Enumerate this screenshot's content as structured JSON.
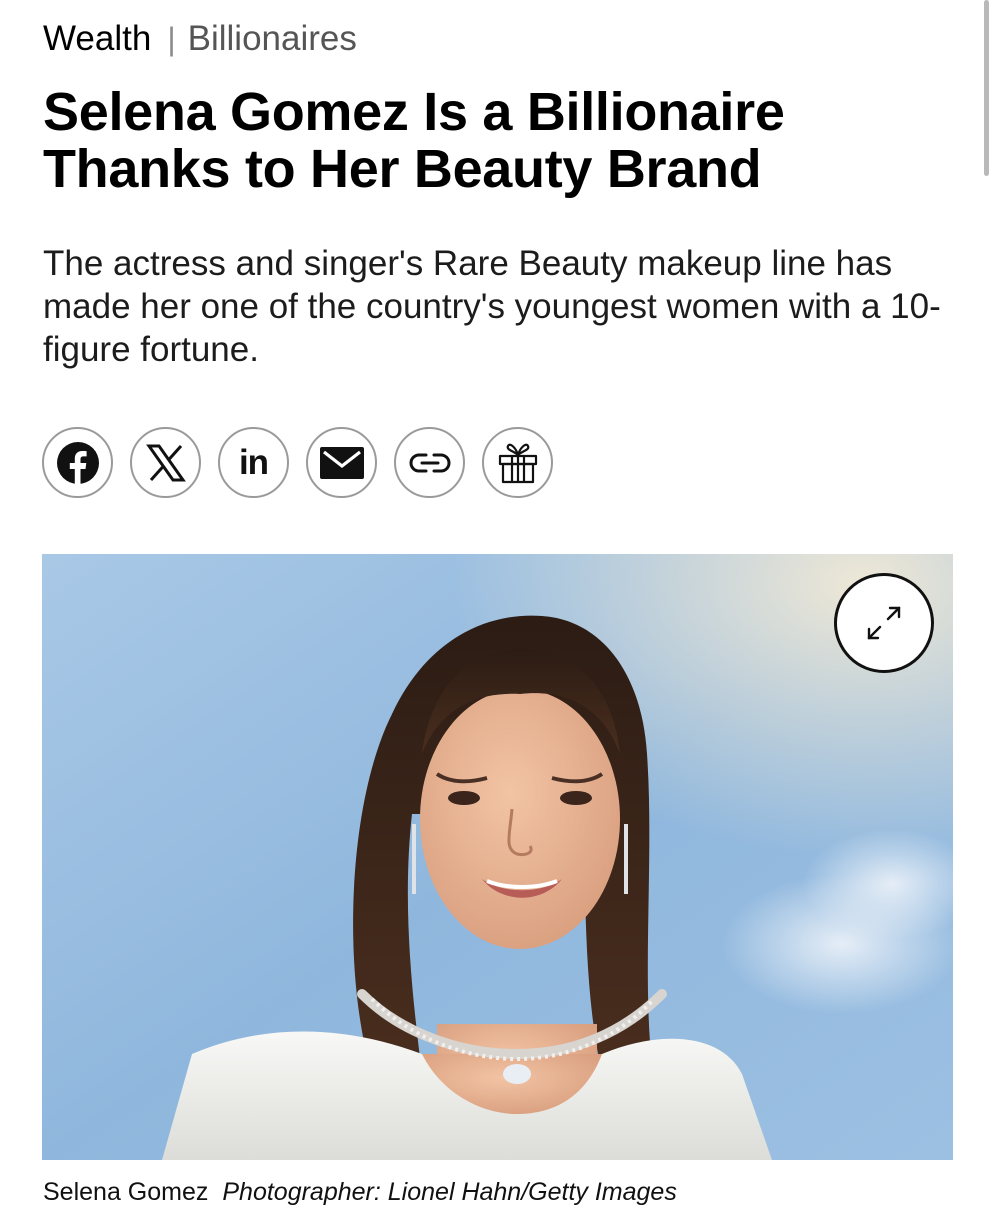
{
  "breadcrumb": {
    "section": "Wealth",
    "separator": "|",
    "subsection": "Billionaires"
  },
  "article": {
    "headline": "Selena Gomez Is a Billionaire Thanks to Her Beauty Brand",
    "dek": "The actress and singer's Rare Beauty makeup line has made her one of the country's youngest women with a 10-figure fortune."
  },
  "share": {
    "buttons": [
      {
        "icon": "facebook-icon"
      },
      {
        "icon": "x-icon"
      },
      {
        "icon": "linkedin-icon",
        "label": "in"
      },
      {
        "icon": "email-icon"
      },
      {
        "icon": "link-icon"
      },
      {
        "icon": "gift-icon"
      }
    ]
  },
  "image": {
    "expand_icon": "expand-icon",
    "caption": "Selena Gomez",
    "credit": "Photographer: Lionel Hahn/Getty Images"
  },
  "colors": {
    "text": "#000000",
    "muted": "#555555",
    "button_border": "#9a9a9a",
    "sky": "#8fb7dd"
  }
}
